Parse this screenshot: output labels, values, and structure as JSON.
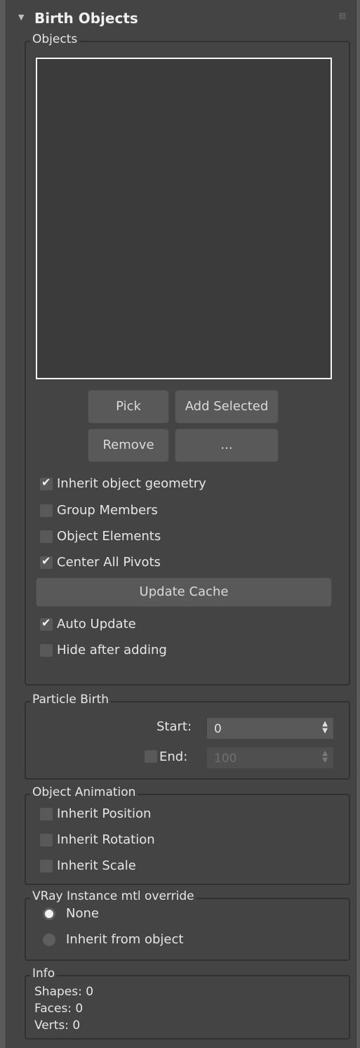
{
  "rollout": {
    "title": "Birth Objects"
  },
  "objects_group": {
    "label": "Objects",
    "buttons": {
      "pick": "Pick",
      "add_selected": "Add Selected",
      "remove": "Remove",
      "more": "..."
    },
    "checkboxes": [
      {
        "label": "Inherit object geometry",
        "checked": true
      },
      {
        "label": "Group Members",
        "checked": false
      },
      {
        "label": "Object Elements",
        "checked": false
      },
      {
        "label": "Center All Pivots",
        "checked": true
      }
    ],
    "update_cache": "Update Cache",
    "checkboxes2": [
      {
        "label": "Auto Update",
        "checked": true
      },
      {
        "label": "Hide after adding",
        "checked": false
      }
    ]
  },
  "particle_birth": {
    "label": "Particle Birth",
    "start_label": "Start:",
    "start_value": "0",
    "end_label": "End:",
    "end_value": "100",
    "end_checked": false
  },
  "object_animation": {
    "label": "Object Animation",
    "checkboxes": [
      {
        "label": "Inherit Position",
        "checked": false
      },
      {
        "label": "Inherit Rotation",
        "checked": false
      },
      {
        "label": "Inherit Scale",
        "checked": false
      }
    ]
  },
  "vray_override": {
    "label": "VRay Instance mtl override",
    "options": [
      {
        "label": "None",
        "selected": true
      },
      {
        "label": "Inherit from object",
        "selected": false
      }
    ]
  },
  "info": {
    "label": "Info",
    "shapes": "Shapes: 0",
    "faces": "Faces: 0",
    "verts": "Verts: 0"
  },
  "check_mark": "✔"
}
